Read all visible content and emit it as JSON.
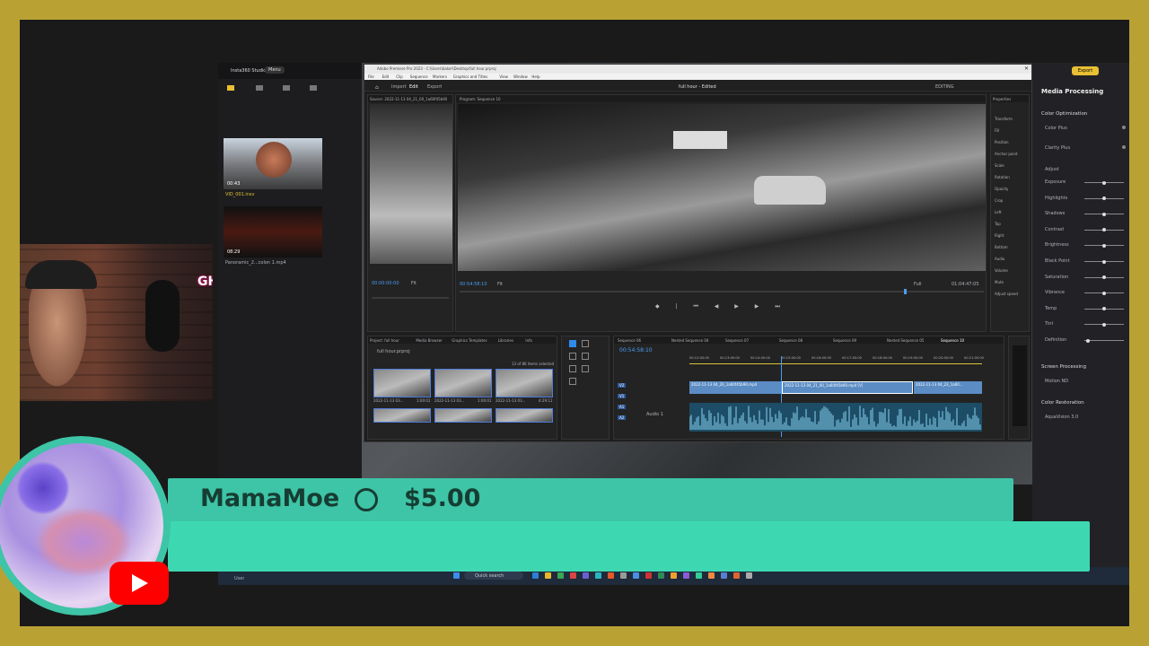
{
  "studio": {
    "title": "Insta360 Studio",
    "menu_label": "Menu",
    "items": [
      {
        "duration": "00:43",
        "name": "VID_001.insv"
      },
      {
        "duration": "08:29",
        "name": "Panoramic_2...colon 1.mp4"
      }
    ]
  },
  "premiere": {
    "window_title": "Adobe Premiere Pro 2023 - C:\\Users\\baker\\Desktop\\full hour.prproj",
    "menus": [
      "File",
      "Edit",
      "Clip",
      "Sequence",
      "Markers",
      "Graphics and Titles",
      "View",
      "Window",
      "Help"
    ],
    "workspace_tabs": [
      "Import",
      "Edit",
      "Export"
    ],
    "project_title": "full hour - Edited",
    "workspace_label": "EDITING",
    "source_title": "Source: 2022-11-13 04_21_00_1a60f45b90",
    "source_timecode": "00:00:00:00",
    "source_zoom": "Fit",
    "program_title": "Program: Sequence 10",
    "program_timecode": "00:54:58:10",
    "program_zoom": "Fit",
    "program_quality": "Full",
    "program_duration": "01:04:47:05",
    "project_panel_tabs": [
      "Project: full hour",
      "Media Browser",
      "Graphics Templates",
      "Libraries",
      "Info"
    ],
    "project_file": "full hour.prproj",
    "items_selected": "13 of 86 items selected",
    "clips": [
      {
        "name": "2022-11-13 03...",
        "dur": "1:00:01"
      },
      {
        "name": "2022-11-13 03...",
        "dur": "1:00:01"
      },
      {
        "name": "2022-11-13 03...",
        "dur": "4:29:11"
      },
      {
        "name": "",
        "dur": ""
      },
      {
        "name": "",
        "dur": ""
      },
      {
        "name": "",
        "dur": ""
      }
    ],
    "sequence_tabs": [
      "Sequence 06",
      "Nested Sequence 04",
      "Sequence 07",
      "Sequence 08",
      "Sequence 09",
      "Nested Sequence 05",
      "Sequence 10"
    ],
    "timeline_timecode": "00:54:58:10",
    "ruler": [
      "00:12:00:00",
      "00:13:00:00",
      "00:14:00:00",
      "00:15:00:00",
      "00:16:00:00",
      "00:17:00:00",
      "00:18:00:00",
      "00:19:00:00",
      "00:20:00:00",
      "00:21:00:00"
    ],
    "track_labels": [
      "V2",
      "V1",
      "A1",
      "A2"
    ],
    "audio_track_name": "Audio 1",
    "clip_labels": [
      "2022-11-13 04_20_1a60f45b90.mp4",
      "2022-11-13 04_21_00_1a60f45b90.mp4 [V]",
      "2022-11-13 04_23_1a60..."
    ],
    "properties_title": "Properties",
    "properties_items": [
      "Transform",
      "Fill",
      "Position",
      "Anchor point",
      "Scale",
      "Rotation",
      "Opacity",
      "Crop",
      "Left",
      "Top",
      "Right",
      "Bottom",
      "Audio",
      "Volume",
      "Mute",
      "Adjust speed"
    ]
  },
  "right_panel": {
    "export_label": "Export",
    "title": "Media Processing",
    "section_color": "Color Optimization",
    "items_color": [
      "Color Plus",
      "Clarity Plus"
    ],
    "adjust_label": "Adjust",
    "sliders": [
      "Exposure",
      "Highlights",
      "Shadows",
      "Contrast",
      "Brightness",
      "Black Point",
      "Saturation",
      "Vibrance",
      "Temp",
      "Tint",
      "Definition"
    ],
    "slider_levels": [
      0.5,
      0.5,
      0.5,
      0.5,
      0.5,
      0.5,
      0.5,
      0.5,
      0.5,
      0.5,
      0.1
    ],
    "section_screen": "Screen Processing",
    "items_screen": [
      "Motion ND"
    ],
    "section_restoration": "Color Restoration",
    "items_restoration": [
      "AquaVision 3.0"
    ]
  },
  "taskbar": {
    "search_placeholder": "Quick search",
    "weather": "User"
  },
  "webcam": {
    "sign_text": "GH"
  },
  "superchat": {
    "name": "MamaMoe",
    "amount": "$5.00",
    "message": ""
  },
  "colors": {
    "frame_gold": "#b9a233",
    "superchat_teal": "#3ec4a6",
    "superchat_teal_light": "#3dd8b2",
    "youtube_red": "#ff0000"
  }
}
